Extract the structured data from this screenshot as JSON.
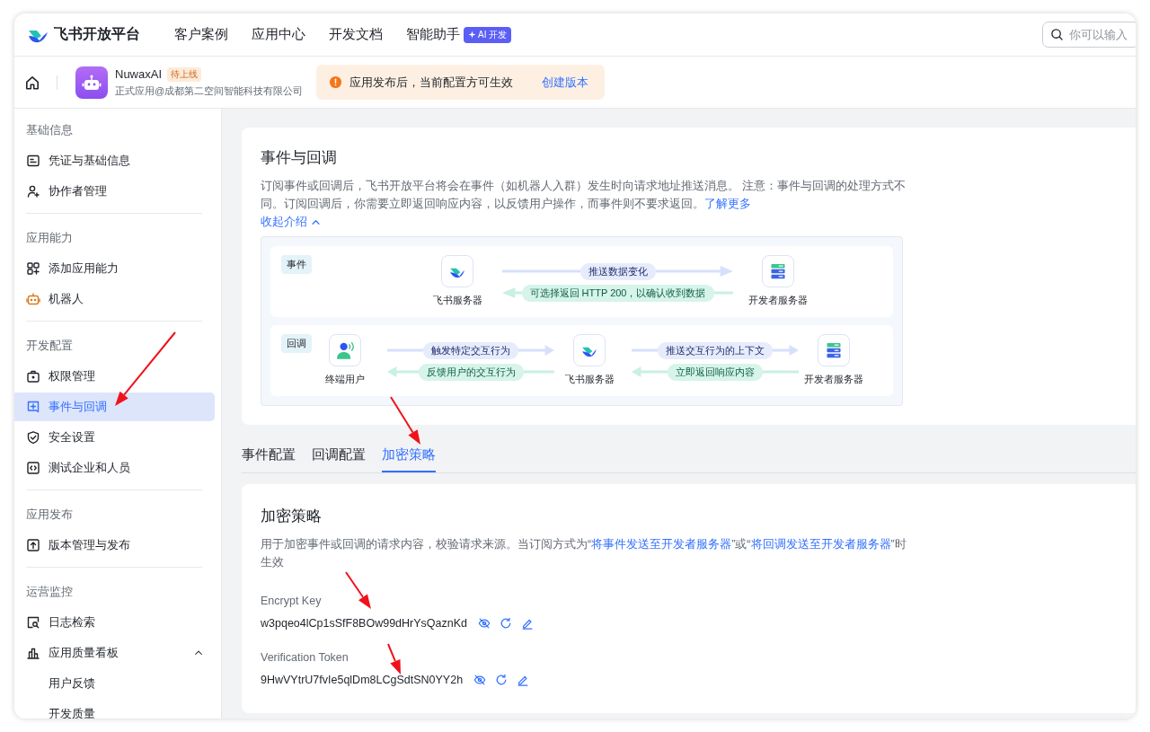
{
  "top_nav": {
    "brand": "飞书开放平台",
    "links": [
      {
        "label": "客户案例"
      },
      {
        "label": "应用中心"
      },
      {
        "label": "开发文档"
      },
      {
        "label": "智能助手",
        "badge": "AI 开发"
      }
    ],
    "search": {
      "placeholder": "你可以输入"
    }
  },
  "app_bar": {
    "app_name": "NuwaxAI",
    "status": "待上线",
    "org": "正式应用@成都第二空间智能科技有限公司",
    "notice": {
      "text": "应用发布后，当前配置方可生效",
      "action": "创建版本"
    }
  },
  "sidebar": {
    "sections": [
      {
        "title": "基础信息",
        "items": [
          {
            "label": "凭证与基础信息",
            "selected": false
          },
          {
            "label": "协作者管理",
            "selected": false
          }
        ]
      },
      {
        "title": "应用能力",
        "items": [
          {
            "label": "添加应用能力",
            "selected": false
          },
          {
            "label": "机器人",
            "selected": false
          }
        ]
      },
      {
        "title": "开发配置",
        "items": [
          {
            "label": "权限管理",
            "selected": false
          },
          {
            "label": "事件与回调",
            "selected": true
          },
          {
            "label": "安全设置",
            "selected": false
          },
          {
            "label": "测试企业和人员",
            "selected": false
          }
        ]
      },
      {
        "title": "应用发布",
        "items": [
          {
            "label": "版本管理与发布",
            "selected": false
          }
        ]
      },
      {
        "title": "运营监控",
        "items": [
          {
            "label": "日志检索",
            "selected": false
          },
          {
            "label": "应用质量看板",
            "selected": false,
            "expanded": true,
            "children": [
              {
                "label": "用户反馈",
                "selected": false
              },
              {
                "label": "开发质量",
                "selected": false
              }
            ]
          }
        ]
      }
    ]
  },
  "intro": {
    "title": "事件与回调",
    "description": "订阅事件或回调后，飞书开放平台将会在事件（如机器人入群）发生时向请求地址推送消息。 注意：事件与回调的处理方式不同。订阅回调后，你需要立即返回响应内容，以反馈用户操作，而事件则不要求返回。",
    "link": "了解更多",
    "collapse": "收起介绍",
    "diagram": {
      "rows": [
        {
          "kind": "event",
          "tag": "事件",
          "nodes": [
            {
              "kind": "platform",
              "label": "飞书服务器"
            },
            {
              "kind": "server",
              "label": "开发者服务器"
            }
          ],
          "flows": [
            {
              "forward": "推送数据变化",
              "back": "可选择返回 HTTP 200，以确认收到数据"
            }
          ]
        },
        {
          "kind": "callback",
          "tag": "回调",
          "nodes": [
            {
              "kind": "user",
              "label": "终端用户"
            },
            {
              "kind": "platform",
              "label": "飞书服务器"
            },
            {
              "kind": "server",
              "label": "开发者服务器"
            }
          ],
          "flows": [
            {
              "forward": "触发特定交互行为",
              "back": "反馈用户的交互行为"
            },
            {
              "forward": "推送交互行为的上下文",
              "back": "立即返回响应内容"
            }
          ]
        }
      ]
    }
  },
  "tabs": [
    {
      "label": "事件配置",
      "selected": false
    },
    {
      "label": "回调配置",
      "selected": false
    },
    {
      "label": "加密策略",
      "selected": true
    }
  ],
  "encryption": {
    "title": "加密策略",
    "description": [
      {
        "kind": "text",
        "text": "用于加密事件或回调的请求内容，校验请求来源。当订阅方式为“"
      },
      {
        "kind": "link",
        "text": "将事件发送至开发者服务器"
      },
      {
        "kind": "text",
        "text": "”或“"
      },
      {
        "kind": "link",
        "text": "将回调发送至开发者服务器"
      },
      {
        "kind": "text",
        "text": "”时生效"
      }
    ],
    "fields": [
      {
        "label": "Encrypt Key",
        "value": "w3pqeo4lCp1sSfF8BOw99dHrYsQaznKd"
      },
      {
        "label": "Verification Token",
        "value": "9HwVYtrU7fvIe5qlDm8LCgSdtSN0YY2h"
      }
    ]
  }
}
